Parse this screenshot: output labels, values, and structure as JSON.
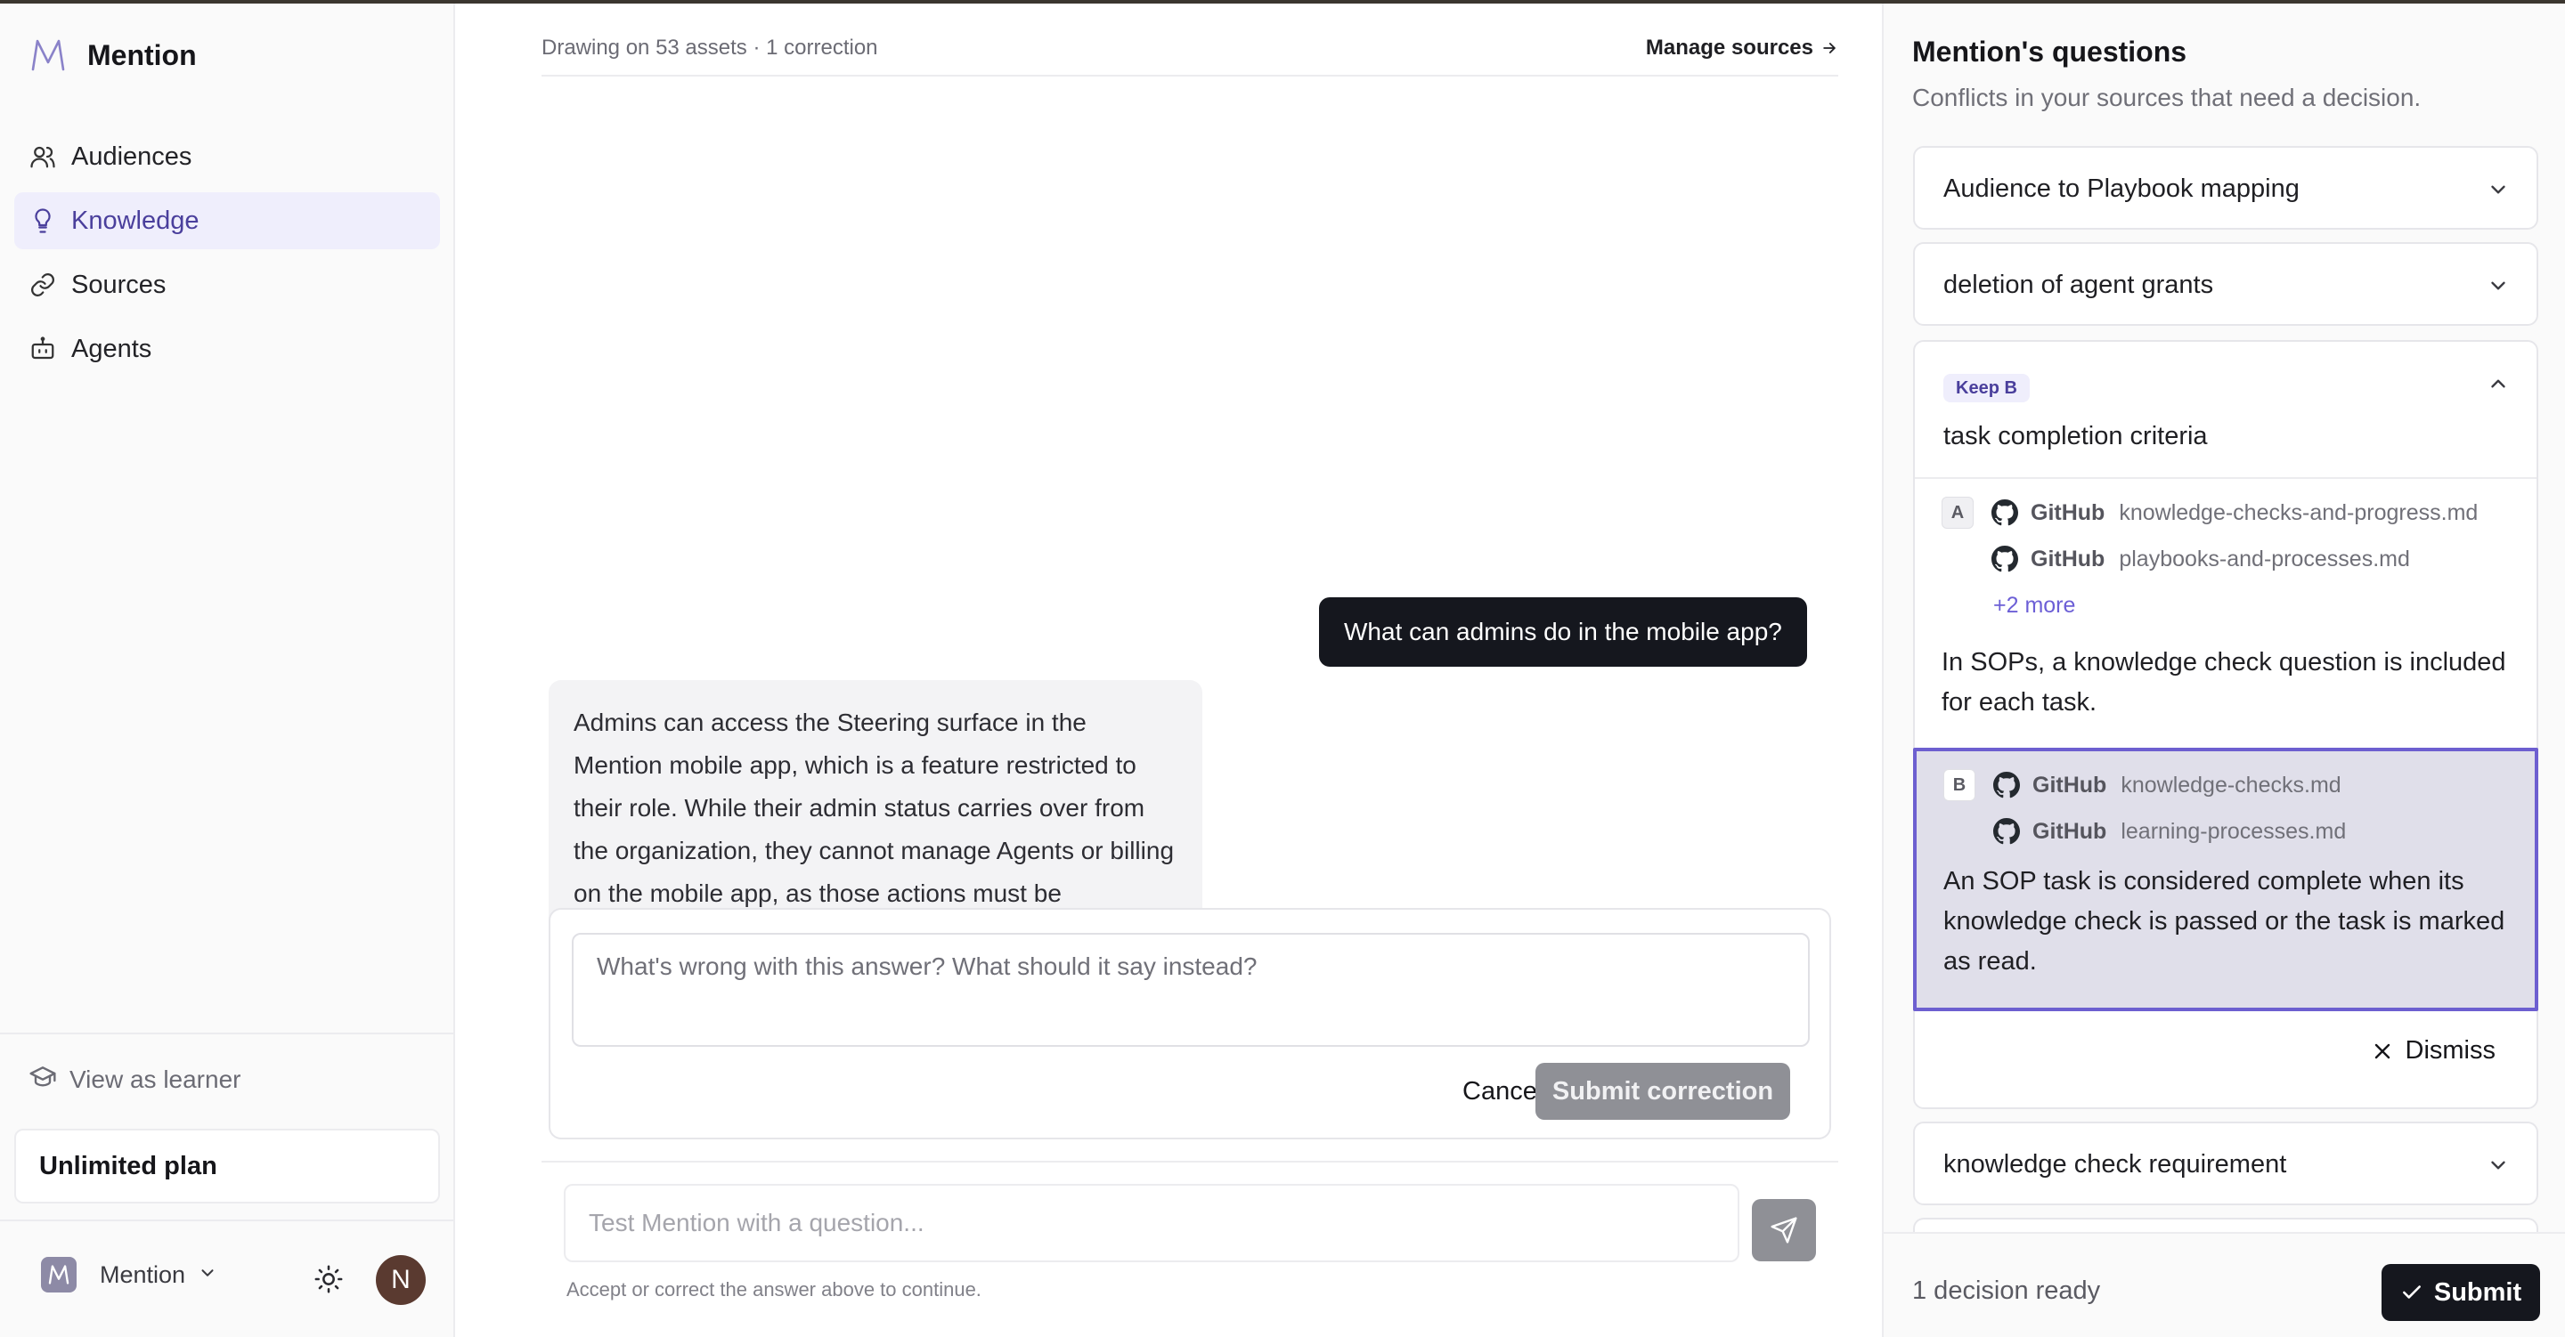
{
  "app": {
    "name": "Mention"
  },
  "sidebar": {
    "items": [
      {
        "label": "Audiences",
        "icon": "users-icon",
        "active": false
      },
      {
        "label": "Knowledge",
        "icon": "lightbulb-icon",
        "active": true
      },
      {
        "label": "Sources",
        "icon": "link-icon",
        "active": false
      },
      {
        "label": "Agents",
        "icon": "bot-icon",
        "active": false
      }
    ],
    "view_as_learner": "View as learner",
    "plan": "Unlimited plan",
    "workspace": "Mention",
    "user_initial": "N"
  },
  "main": {
    "info": "Drawing on 53 assets · 1 correction",
    "manage_sources": "Manage sources",
    "user_message": "What can admins do in the mobile app?",
    "bot_message": "Admins can access the Steering surface in the Mention mobile app, which is a feature restricted to their role. While their admin status carries over from the organization, they cannot manage Agents or billing on the mobile app, as those actions must be performed on the web app.",
    "correction_placeholder": "What's wrong with this answer? What should it say instead?",
    "cancel_label": "Cancel",
    "submit_correction_label": "Submit correction",
    "composer_placeholder": "Test Mention with a question...",
    "hint": "Accept or correct the answer above to continue."
  },
  "questions": {
    "title": "Mention's questions",
    "subtitle": "Conflicts in your sources that need a decision.",
    "collapsed_top": [
      {
        "label": "Audience to Playbook mapping"
      },
      {
        "label": "deletion of agent grants"
      }
    ],
    "expanded": {
      "badge": "Keep B",
      "label": "task completion criteria",
      "option_a": {
        "letter": "A",
        "sources": [
          {
            "provider": "GitHub",
            "file": "knowledge-checks-and-progress.md"
          },
          {
            "provider": "GitHub",
            "file": "playbooks-and-processes.md"
          }
        ],
        "more": "+2 more",
        "text": "In SOPs, a knowledge check question is included for each task."
      },
      "option_b": {
        "letter": "B",
        "sources": [
          {
            "provider": "GitHub",
            "file": "knowledge-checks.md"
          },
          {
            "provider": "GitHub",
            "file": "learning-processes.md"
          }
        ],
        "text": "An SOP task is considered complete when its knowledge check is passed or the task is marked as read."
      },
      "dismiss_label": "Dismiss"
    },
    "collapsed_bottom": [
      {
        "label": "knowledge check requirement"
      }
    ],
    "footer": {
      "ready": "1 decision ready",
      "submit_label": "Submit"
    }
  },
  "colors": {
    "accent": "#6d5fd0",
    "active_nav_bg": "#efeefc",
    "dark_button": "#15171e"
  }
}
